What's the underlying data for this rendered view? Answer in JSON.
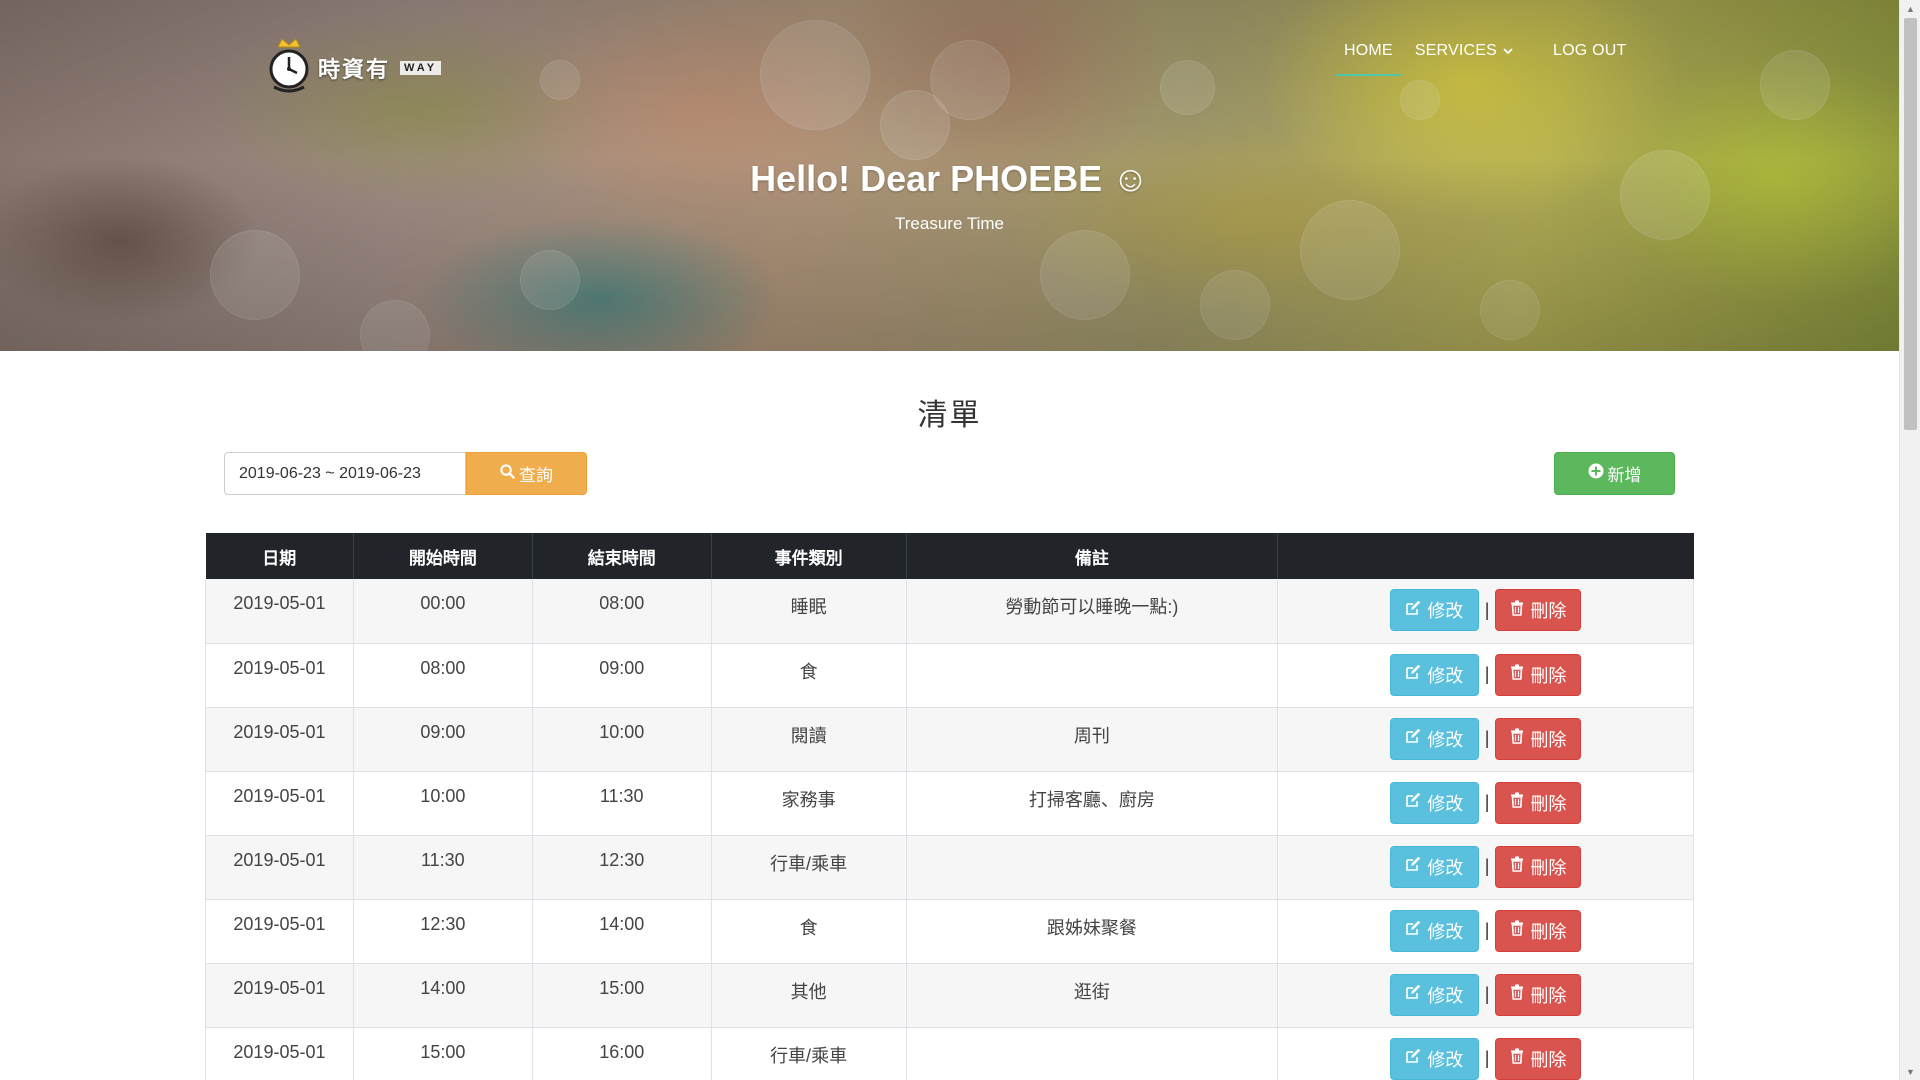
{
  "brand": {
    "name": "時資有",
    "suffix": "WAY"
  },
  "nav": {
    "items": [
      {
        "label": "HOME",
        "active": true
      },
      {
        "label": "SERVICES",
        "dropdown": true
      },
      {
        "label": "LOG OUT"
      }
    ]
  },
  "hero": {
    "title": "Hello! Dear PHOEBE ☺",
    "subtitle": "Treasure Time"
  },
  "list": {
    "title": "清單",
    "date_range": "2019-06-23 ~ 2019-06-23",
    "query_label": "查詢",
    "add_label": "新增"
  },
  "table": {
    "headers": [
      "日期",
      "開始時間",
      "結束時間",
      "事件類別",
      "備註",
      ""
    ],
    "edit_label": "修改",
    "delete_label": "刪除",
    "separator": "|",
    "rows": [
      [
        "2019-05-01",
        "00:00",
        "08:00",
        "睡眠",
        "勞動節可以睡晚一點:)"
      ],
      [
        "2019-05-01",
        "08:00",
        "09:00",
        "食",
        ""
      ],
      [
        "2019-05-01",
        "09:00",
        "10:00",
        "閱讀",
        "周刊"
      ],
      [
        "2019-05-01",
        "10:00",
        "11:30",
        "家務事",
        "打掃客廳、廚房"
      ],
      [
        "2019-05-01",
        "11:30",
        "12:30",
        "行車/乘車",
        ""
      ],
      [
        "2019-05-01",
        "12:30",
        "14:00",
        "食",
        "跟姊妹聚餐"
      ],
      [
        "2019-05-01",
        "14:00",
        "15:00",
        "其他",
        "逛街"
      ],
      [
        "2019-05-01",
        "15:00",
        "16:00",
        "行車/乘車",
        ""
      ]
    ]
  },
  "colors": {
    "accent_underline": "#4cc9a8",
    "warning": "#f0ad4e",
    "success": "#5cb85c",
    "info": "#5bc0de",
    "danger": "#d9534f",
    "table_header": "#212529"
  },
  "icons": {
    "query": "search-icon",
    "add": "plus-circle-icon",
    "edit": "edit-icon",
    "delete": "trash-icon",
    "services": "chevron-down-icon"
  }
}
